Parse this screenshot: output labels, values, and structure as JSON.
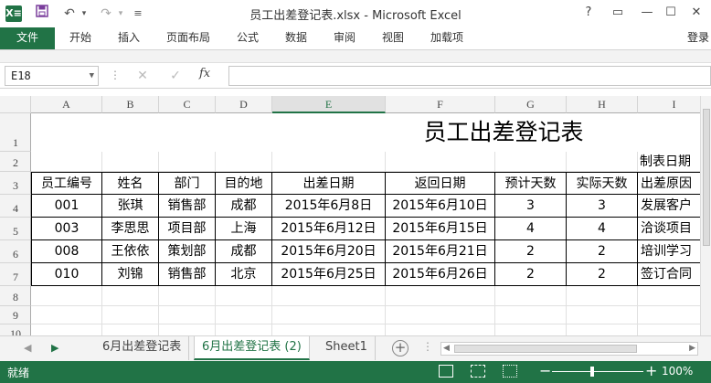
{
  "window": {
    "title": "员工出差登记表.xlsx - Microsoft Excel",
    "logo": "X≡",
    "controls": {
      "help": "?",
      "ribbon_display": "▭",
      "minimize": "—",
      "restore": "☐",
      "close": "✕"
    }
  },
  "quick_access": {
    "save_icon": "save-icon",
    "undo": "↶",
    "redo": "↷",
    "customize": "≡"
  },
  "ribbon": {
    "file": "文件",
    "tabs": [
      "开始",
      "插入",
      "页面布局",
      "公式",
      "数据",
      "审阅",
      "视图",
      "加载项"
    ],
    "login": "登录"
  },
  "formula_bar": {
    "name_box": "E18",
    "cancel": "✕",
    "confirm": "✓",
    "fx": "fx",
    "value": ""
  },
  "columns": [
    "A",
    "B",
    "C",
    "D",
    "E",
    "F",
    "G",
    "H",
    "I"
  ],
  "rows": [
    "1",
    "2",
    "3",
    "4",
    "5",
    "6",
    "7",
    "8",
    "9",
    "10"
  ],
  "sheet": {
    "title": "员工出差登记表",
    "made_date_label": "制表日期",
    "headers": [
      "员工编号",
      "姓名",
      "部门",
      "目的地",
      "出差日期",
      "返回日期",
      "预计天数",
      "实际天数",
      "出差原因"
    ],
    "records": [
      [
        "001",
        "张琪",
        "销售部",
        "成都",
        "2015年6月8日",
        "2015年6月10日",
        "3",
        "3",
        "发展客户"
      ],
      [
        "003",
        "李思思",
        "项目部",
        "上海",
        "2015年6月12日",
        "2015年6月15日",
        "4",
        "4",
        "洽谈项目"
      ],
      [
        "008",
        "王依依",
        "策划部",
        "成都",
        "2015年6月20日",
        "2015年6月21日",
        "2",
        "2",
        "培训学习"
      ],
      [
        "010",
        "刘锦",
        "销售部",
        "北京",
        "2015年6月25日",
        "2015年6月26日",
        "2",
        "2",
        "签订合同"
      ]
    ]
  },
  "sheet_tabs": {
    "tabs": [
      "6月出差登记表",
      "6月出差登记表 (2)",
      "Sheet1"
    ],
    "active_index": 1,
    "add": "+"
  },
  "status": {
    "ready": "就绪",
    "zoom": "100%",
    "zoom_minus": "−",
    "zoom_plus": "+"
  }
}
